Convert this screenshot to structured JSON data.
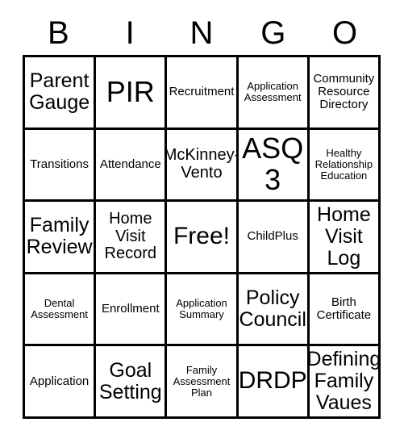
{
  "card": {
    "header_letters": [
      "B",
      "I",
      "N",
      "G",
      "O"
    ],
    "border_color": "#000000",
    "background_color": "#ffffff",
    "text_color": "#000000",
    "rows": [
      [
        {
          "label": "Parent Gauge",
          "size": "lg"
        },
        {
          "label": "PIR",
          "size": "xxl"
        },
        {
          "label": "Recruitment",
          "size": "sm"
        },
        {
          "label": "Application Assessment",
          "size": "xs"
        },
        {
          "label": "Community Resource Directory",
          "size": "sm"
        }
      ],
      [
        {
          "label": "Transitions",
          "size": "sm"
        },
        {
          "label": "Attendance",
          "size": "sm"
        },
        {
          "label": "McKinney-Vento",
          "size": "md"
        },
        {
          "label": "ASQ 3",
          "size": "xxl"
        },
        {
          "label": "Healthy Relationship Education",
          "size": "xs"
        }
      ],
      [
        {
          "label": "Family Review",
          "size": "lg"
        },
        {
          "label": "Home Visit Record",
          "size": "md"
        },
        {
          "label": "Free!",
          "size": "xl"
        },
        {
          "label": "ChildPlus",
          "size": "sm"
        },
        {
          "label": "Home Visit Log",
          "size": "lg"
        }
      ],
      [
        {
          "label": "Dental Assessment",
          "size": "xs"
        },
        {
          "label": "Enrollment",
          "size": "sm"
        },
        {
          "label": "Application Summary",
          "size": "xs"
        },
        {
          "label": "Policy Council",
          "size": "lg"
        },
        {
          "label": "Birth Certificate",
          "size": "sm"
        }
      ],
      [
        {
          "label": "Application",
          "size": "sm"
        },
        {
          "label": "Goal Setting",
          "size": "lg"
        },
        {
          "label": "Family Assessment Plan",
          "size": "xs"
        },
        {
          "label": "DRDP",
          "size": "xl"
        },
        {
          "label": "Defining Family Vaues",
          "size": "lg"
        }
      ]
    ]
  }
}
